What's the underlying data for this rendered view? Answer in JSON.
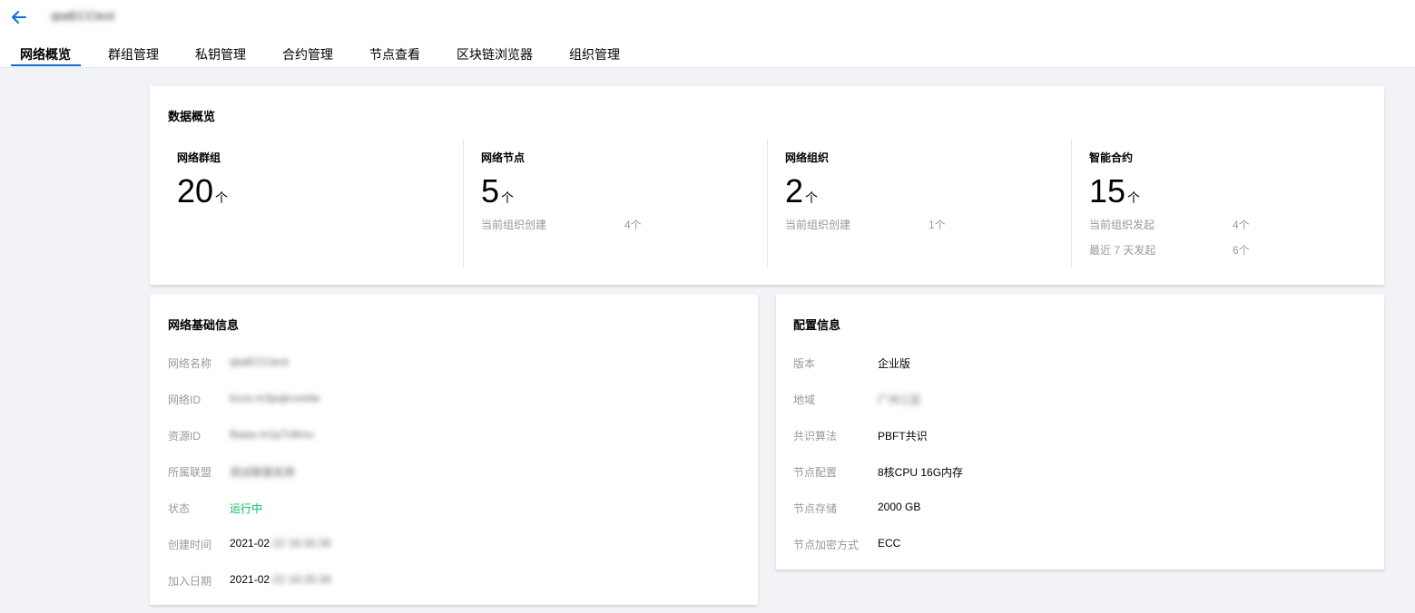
{
  "header": {
    "network_title": "qtatECCtest",
    "tabs": [
      {
        "label": "网络概览",
        "active": true
      },
      {
        "label": "群组管理",
        "active": false
      },
      {
        "label": "私钥管理",
        "active": false
      },
      {
        "label": "合约管理",
        "active": false
      },
      {
        "label": "节点查看",
        "active": false
      },
      {
        "label": "区块链浏览器",
        "active": false
      },
      {
        "label": "组织管理",
        "active": false
      }
    ]
  },
  "overview": {
    "title": "数据概览",
    "stats": [
      {
        "label": "网络群组",
        "value": "20",
        "unit": "个",
        "rows": []
      },
      {
        "label": "网络节点",
        "value": "5",
        "unit": "个",
        "rows": [
          {
            "label": "当前组织创建",
            "value": "4个"
          }
        ]
      },
      {
        "label": "网络组织",
        "value": "2",
        "unit": "个",
        "rows": [
          {
            "label": "当前组织创建",
            "value": "1个"
          }
        ]
      },
      {
        "label": "智能合约",
        "value": "15",
        "unit": "个",
        "rows": [
          {
            "label": "当前组织发起",
            "value": "4个"
          },
          {
            "label": "最近 7 天发起",
            "value": "6个"
          }
        ]
      }
    ]
  },
  "basic_info": {
    "title": "网络基础信息",
    "rows": [
      {
        "label": "网络名称",
        "value": "qtatECCtest",
        "blur": true
      },
      {
        "label": "网络ID",
        "value": "bcos-m3pqkcvedw",
        "blur": true
      },
      {
        "label": "资源ID",
        "value": "fbaas-m1p7v8mu",
        "blur": true
      },
      {
        "label": "所属联盟",
        "value": "测试联盟名称",
        "blur": true
      },
      {
        "label": "状态",
        "value": "运行中",
        "status": true
      },
      {
        "label": "创建时间",
        "value_prefix": "2021-02",
        "value_blur": "-22 16:35:39"
      },
      {
        "label": "加入日期",
        "value_prefix": "2021-02",
        "value_blur": "-22 16:35:39"
      }
    ]
  },
  "config_info": {
    "title": "配置信息",
    "rows": [
      {
        "label": "版本",
        "value": "企业版"
      },
      {
        "label": "地域",
        "value": "广州三区",
        "blur": true
      },
      {
        "label": "共识算法",
        "value": "PBFT共识"
      },
      {
        "label": "节点配置",
        "value": "8核CPU 16G内存"
      },
      {
        "label": "节点存储",
        "value": "2000 GB"
      },
      {
        "label": "节点加密方式",
        "value": "ECC"
      }
    ]
  },
  "colors": {
    "accent": "#006eff",
    "status_running": "#0abf5b",
    "muted_text": "#999999"
  },
  "icons": {
    "back": "arrow-left-icon"
  }
}
